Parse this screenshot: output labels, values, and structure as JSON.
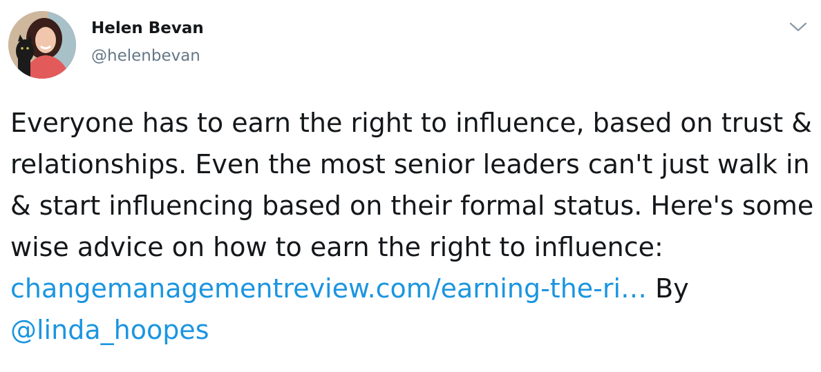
{
  "tweet": {
    "author": {
      "name": "Helen Bevan",
      "handle": "@helenbevan",
      "avatar_icon": "profile-photo-avatar"
    },
    "menu_icon": "chevron-down-icon",
    "text_before_link": "Everyone has to earn the right to influence, based on trust & relationships. Even the most senior leaders can't just walk in & start influencing based on their formal status. Here's some wise advice on how to earn the right to influence: ",
    "link_text": "changemanagementreview.com/earning-the-ri…",
    "text_between": " By ",
    "mention": "@linda_hoopes"
  },
  "colors": {
    "text": "#14171a",
    "secondary": "#657786",
    "link": "#1b95e0"
  }
}
